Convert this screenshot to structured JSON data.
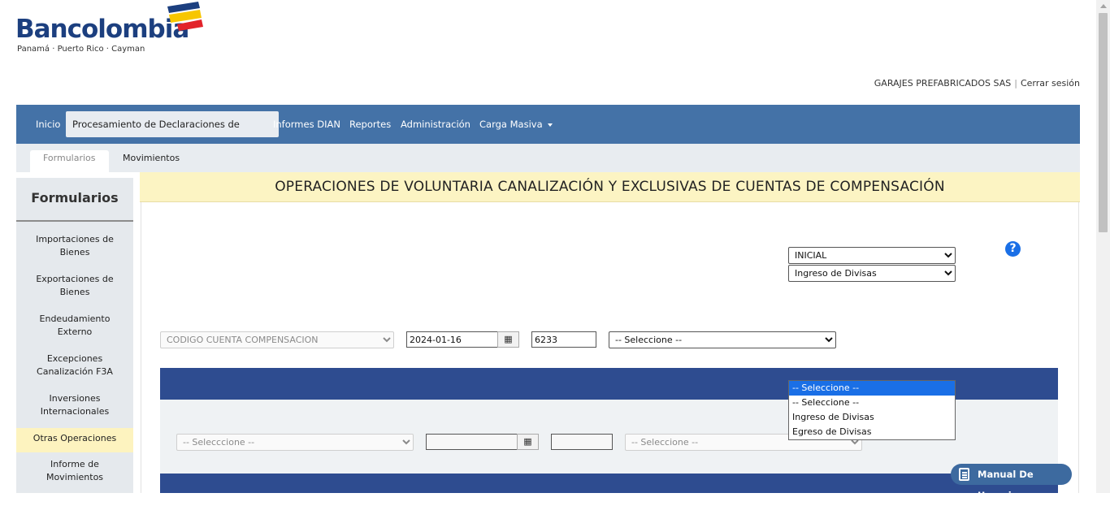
{
  "brand": {
    "name": "Bancolombia",
    "subtitle": "Panamá · Puerto Rico · Cayman",
    "colors": {
      "blue": "#1c3f7f",
      "yellow": "#f7c600",
      "red": "#e2232a"
    }
  },
  "user": {
    "company": "GARAJES PREFABRICADOS SAS",
    "separator": "|",
    "logout": "Cerrar sesión"
  },
  "nav": {
    "items": [
      {
        "label": "Inicio"
      },
      {
        "label": "Procesamiento de Declaraciones de cambio"
      },
      {
        "label": "Informes DIAN"
      },
      {
        "label": "Reportes"
      },
      {
        "label": "Administración"
      },
      {
        "label": "Carga Masiva"
      }
    ],
    "active": "Procesamiento de Declaraciones de cambio"
  },
  "subnav": {
    "tabs": [
      {
        "label": "Formularios"
      },
      {
        "label": "Movimientos"
      }
    ],
    "active": "Formularios"
  },
  "sidebar": {
    "title": "Formularios",
    "items": [
      {
        "line1": "Importaciones de",
        "line2": "Bienes"
      },
      {
        "line1": "Exportaciones de",
        "line2": "Bienes"
      },
      {
        "line1": "Endeudamiento",
        "line2": "Externo"
      },
      {
        "line1": "Excepciones",
        "line2": "Canalización F3A"
      },
      {
        "line1": "Inversiones",
        "line2": "Internacionales"
      },
      {
        "line1": "Otras Operaciones",
        "line2": ""
      },
      {
        "line1": "Informe de",
        "line2": "Movimientos"
      }
    ],
    "active": "Otras Operaciones"
  },
  "form": {
    "title": "OPERACIONES DE VOLUNTARIA CANALIZACIÓN Y EXCLUSIVAS DE CUENTAS DE COMPENSACIÓN",
    "type_select": "INICIAL",
    "flow_select": "Ingreso de Divisas",
    "account_select": "CODIGO CUENTA COMPENSACION",
    "date": "2024-01-16",
    "code": "6233",
    "row1_select": "-- Seleccione --",
    "row2_select1": "-- Selecccione --",
    "row2_select2": "-- Seleccione --",
    "dropdown": {
      "options": [
        "-- Seleccione --",
        "-- Seleccione --",
        "Ingreso de Divisas",
        "Egreso de Divisas"
      ],
      "highlighted_index": 0
    },
    "help_icon": "question-circle-icon",
    "calendar_icon": "calendar-icon"
  },
  "manual": {
    "label": "Manual De Usuario",
    "icon": "book-icon"
  }
}
